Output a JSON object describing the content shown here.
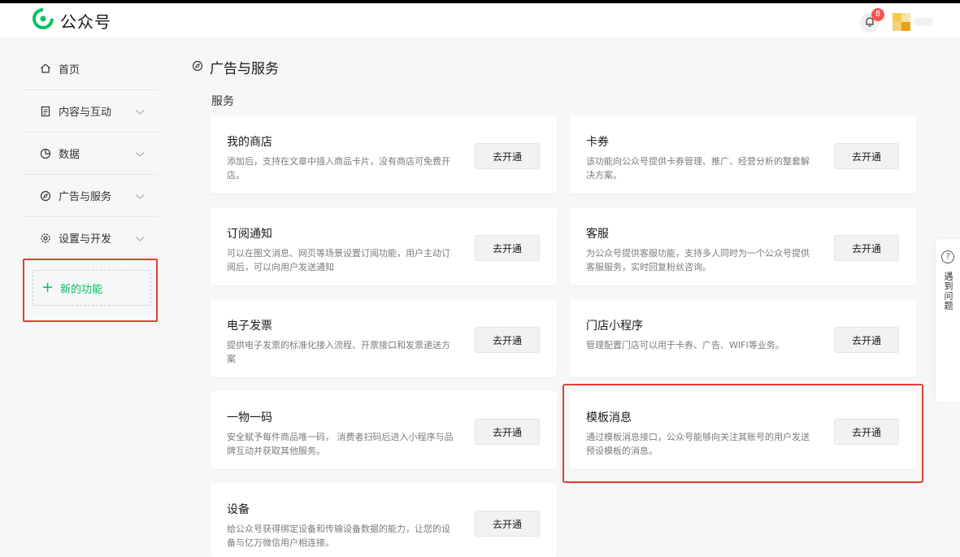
{
  "brand": {
    "title": "公众号",
    "accent": "#07c160"
  },
  "header": {
    "notification_count": "8"
  },
  "sidebar": {
    "items": [
      {
        "label": "首页",
        "icon": "home-icon"
      },
      {
        "label": "内容与互动",
        "icon": "document-icon"
      },
      {
        "label": "数据",
        "icon": "pie-chart-icon"
      },
      {
        "label": "广告与服务",
        "icon": "compass-icon"
      },
      {
        "label": "设置与开发",
        "icon": "gear-icon"
      }
    ],
    "new_feature_label": "新的功能"
  },
  "page": {
    "title": "广告与服务",
    "section": "服务"
  },
  "cards": [
    {
      "title": "我的商店",
      "desc": "添加后，支持在文章中插入商品卡片，没有商店可免费开店。",
      "button": "去开通"
    },
    {
      "title": "卡券",
      "desc": "该功能向公众号提供卡券管理、推广、经营分析的整套解决方案。",
      "button": "去开通"
    },
    {
      "title": "订阅通知",
      "desc": "可以在图文消息、网页等场景设置订阅功能，用户主动订阅后，可以向用户发送通知",
      "button": "去开通"
    },
    {
      "title": "客服",
      "desc": "为公众号提供客服功能，支持多人同时为一个公众号提供客服服务，实时回复粉丝咨询。",
      "button": "去开通"
    },
    {
      "title": "电子发票",
      "desc": "提供电子发票的标准化接入流程、开票接口和发票递送方案",
      "button": "去开通"
    },
    {
      "title": "门店小程序",
      "desc": "管理配置门店可以用于卡券、广告、WIFI等业务。",
      "button": "去开通"
    },
    {
      "title": "一物一码",
      "desc": "安全赋予每件商品唯一码， 消费者扫码后进入小程序与品牌互动并获取其他服务。",
      "button": "去开通"
    },
    {
      "title": "模板消息",
      "desc": "通过模板消息接口，公众号能够向关注其账号的用户发送预设模板的消息。",
      "button": "去开通"
    },
    {
      "title": "设备",
      "desc": "给公众号获得绑定设备和传输设备数据的能力，让您的设备与亿万微信用户相连接。",
      "button": "去开通"
    }
  ],
  "help": {
    "label": "遇到问题"
  },
  "colors": {
    "highlight": "#e53e2f",
    "badge": "#fa5151"
  }
}
